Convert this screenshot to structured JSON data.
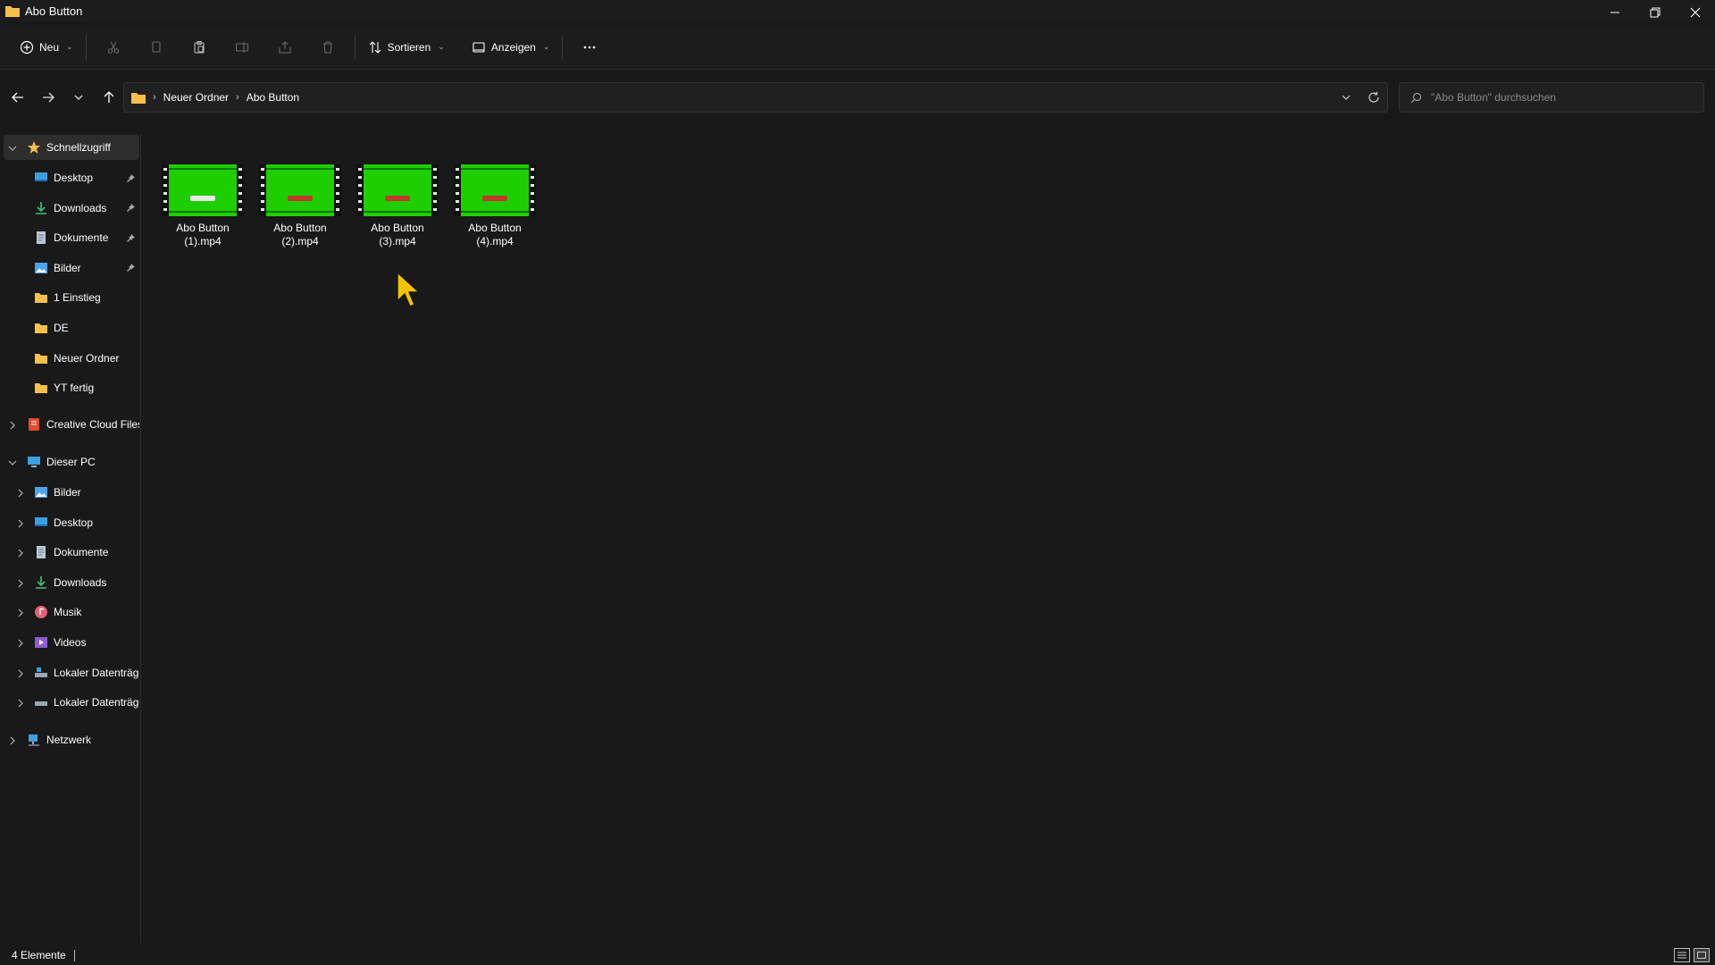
{
  "window": {
    "title": "Abo Button"
  },
  "commandbar": {
    "new_label": "Neu",
    "sort_label": "Sortieren",
    "view_label": "Anzeigen"
  },
  "address": {
    "crumbs": [
      "Neuer Ordner",
      "Abo Button"
    ]
  },
  "search": {
    "placeholder": "\"Abo Button\" durchsuchen"
  },
  "sidebar": {
    "quick_access": {
      "label": "Schnellzugriff",
      "items": [
        {
          "label": "Desktop",
          "icon": "desktop-icon",
          "pinned": true
        },
        {
          "label": "Downloads",
          "icon": "download-icon",
          "pinned": true
        },
        {
          "label": "Dokumente",
          "icon": "document-icon",
          "pinned": true
        },
        {
          "label": "Bilder",
          "icon": "pictures-icon",
          "pinned": true
        },
        {
          "label": "1 Einstieg",
          "icon": "folder-icon",
          "pinned": false
        },
        {
          "label": "DE",
          "icon": "folder-icon",
          "pinned": false
        },
        {
          "label": "Neuer Ordner",
          "icon": "folder-icon",
          "pinned": false
        },
        {
          "label": "YT fertig",
          "icon": "folder-icon",
          "pinned": false
        }
      ]
    },
    "creative_cloud": {
      "label": "Creative Cloud Files"
    },
    "this_pc": {
      "label": "Dieser PC",
      "items": [
        {
          "label": "Bilder",
          "icon": "pictures-icon"
        },
        {
          "label": "Desktop",
          "icon": "desktop-icon"
        },
        {
          "label": "Dokumente",
          "icon": "document-icon"
        },
        {
          "label": "Downloads",
          "icon": "download-icon"
        },
        {
          "label": "Musik",
          "icon": "music-icon"
        },
        {
          "label": "Videos",
          "icon": "videos-icon"
        },
        {
          "label": "Lokaler Datenträger (C:)",
          "icon": "drive-c-icon"
        },
        {
          "label": "Lokaler Datenträger (D:)",
          "icon": "drive-icon"
        }
      ]
    },
    "network": {
      "label": "Netzwerk"
    }
  },
  "files": [
    {
      "line1": "Abo Button",
      "line2": "(1).mp4",
      "pill_color": "#e8e8e8"
    },
    {
      "line1": "Abo Button",
      "line2": "(2).mp4",
      "pill_color": "#c0392b"
    },
    {
      "line1": "Abo Button",
      "line2": "(3).mp4",
      "pill_color": "#c0392b"
    },
    {
      "line1": "Abo Button",
      "line2": "(4).mp4",
      "pill_color": "#c0392b"
    }
  ],
  "status": {
    "count": "4 Elemente"
  },
  "colors": {
    "background": "#191919",
    "thumb_green": "#1dcf00",
    "folder_yellow": "#f5c14a",
    "cursor_yellow": "#f5c400"
  }
}
